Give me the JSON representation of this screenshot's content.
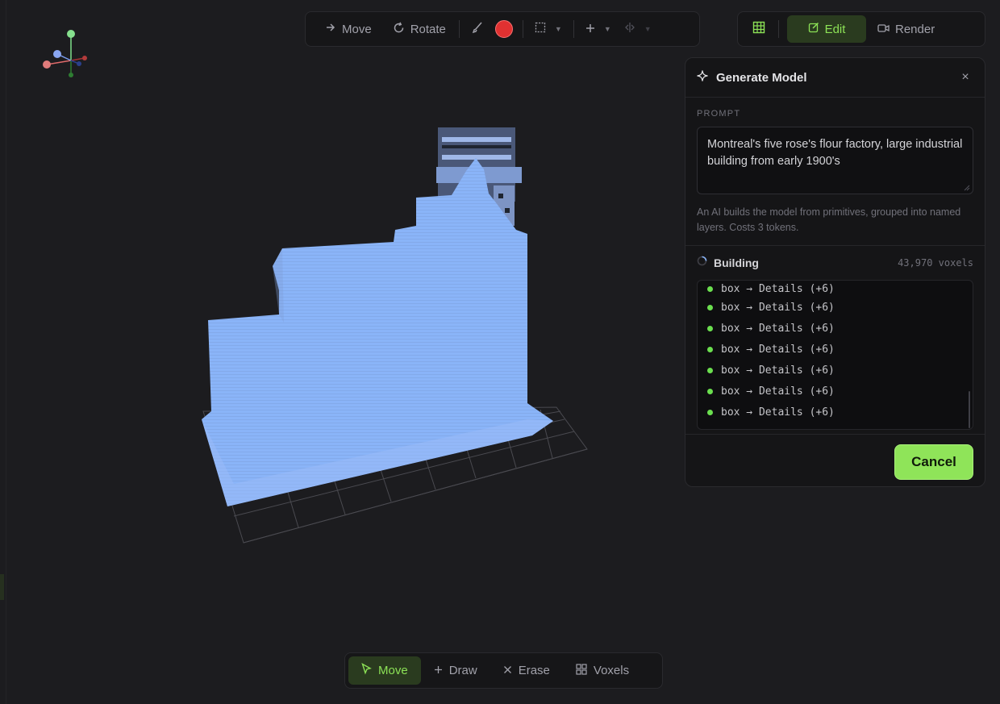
{
  "toolbar": {
    "move_label": "Move",
    "rotate_label": "Rotate",
    "paint_color": "#e03131"
  },
  "modebar": {
    "edit_label": "Edit",
    "render_label": "Render"
  },
  "panel": {
    "title": "Generate Model",
    "close_glyph": "×",
    "prompt_label": "PROMPT",
    "prompt_value": "Montreal's five rose's flour factory, large industrial building from early 1900's",
    "hint": "An AI builds the model from primitives, grouped into named layers. Costs 3 tokens.",
    "status_label": "Building",
    "voxel_count": "43,970 voxels",
    "log": [
      "box → Details (+6)",
      "box → Details (+6)",
      "box → Details (+6)",
      "box → Details (+6)",
      "box → Details (+6)",
      "box → Details (+6)",
      "box → Details (+6)"
    ],
    "cancel_label": "Cancel"
  },
  "bottombar": {
    "move_label": "Move",
    "draw_label": "Draw",
    "erase_label": "Erase",
    "voxels_label": "Voxels"
  },
  "colors": {
    "accent": "#8ce256",
    "model": "#8ab4f8",
    "status_dot": "#6bdf4f"
  },
  "icons": [
    "arrow-right-icon",
    "rotate-icon",
    "brush-icon",
    "select-box-icon",
    "plus-icon",
    "mirror-icon",
    "grid-icon",
    "edit-icon",
    "camera-icon",
    "sparkle-icon",
    "close-icon",
    "spinner-icon",
    "cursor-icon",
    "erase-x-icon",
    "voxels-icon"
  ]
}
